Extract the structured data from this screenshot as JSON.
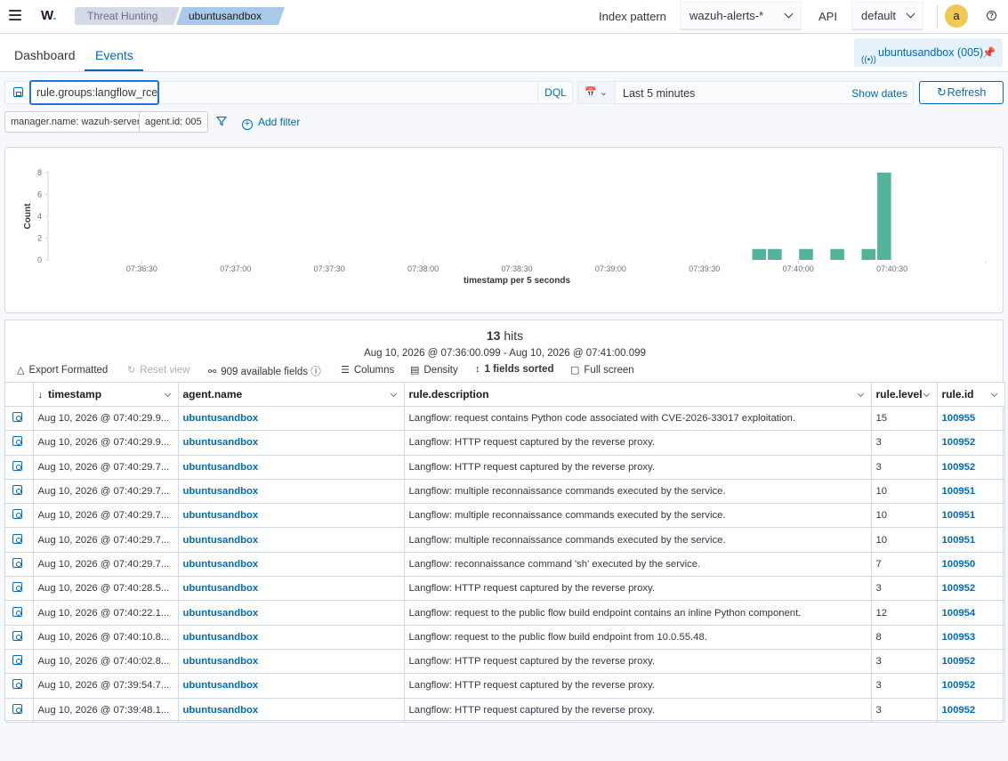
{
  "header": {
    "logo": "W",
    "breadcrumbs": [
      "Threat Hunting",
      "ubuntusandbox"
    ],
    "index_pattern_label": "Index pattern",
    "index_pattern_value": "wazuh-alerts-*",
    "api_label": "API",
    "api_value": "default",
    "avatar_letter": "a",
    "help": "?"
  },
  "tabs": [
    {
      "label": "Dashboard",
      "active": false
    },
    {
      "label": "Events",
      "active": true
    }
  ],
  "agent_pill": "ubuntusandbox (005)",
  "search": {
    "query": "rule.groups:langflow_rce",
    "language": "DQL"
  },
  "date_picker": {
    "value": "Last 5 minutes",
    "show_dates": "Show dates",
    "refresh": "Refresh"
  },
  "filters": {
    "pills": [
      "manager.name: wazuh-server",
      "agent.id: 005"
    ],
    "add_filter": "Add filter"
  },
  "chart_data": {
    "type": "bar",
    "ylabel": "Count",
    "xlabel": "timestamp per 5 seconds",
    "y_ticks": [
      0,
      2,
      4,
      6,
      8
    ],
    "ylim": [
      0,
      8
    ],
    "x_tick_labels": [
      "07:36:30",
      "07:37:00",
      "07:37:30",
      "07:38:00",
      "07:38:30",
      "07:39:00",
      "07:39:30",
      "07:40:00",
      "07:40:30"
    ],
    "x_range": [
      "07:36:00",
      "07:41:00"
    ],
    "bars": [
      {
        "x": "07:39:45",
        "value": 1
      },
      {
        "x": "07:39:50",
        "value": 1
      },
      {
        "x": "07:40:00",
        "value": 1
      },
      {
        "x": "07:40:10",
        "value": 1
      },
      {
        "x": "07:40:20",
        "value": 1
      },
      {
        "x": "07:40:25",
        "value": 8
      }
    ],
    "color": "#54b399"
  },
  "results": {
    "hits_count": "13",
    "hits_label": "hits",
    "range": "Aug 10, 2026 @ 07:36:00.099 - Aug 10, 2026 @ 07:41:00.099",
    "toolbar": {
      "export": "Export Formatted",
      "reset": "Reset view",
      "fields": "909 available fields",
      "columns": "Columns",
      "density": "Density",
      "sorted": "1 fields sorted",
      "fullscreen": "Full screen"
    },
    "columns": [
      "timestamp",
      "agent.name",
      "rule.description",
      "rule.level",
      "rule.id"
    ],
    "rows": [
      {
        "timestamp": "Aug 10, 2026 @ 07:40:29.9...",
        "agent": "ubuntusandbox",
        "description": "Langflow: request contains Python code associated with CVE-2026-33017 exploitation.",
        "level": "15",
        "id": "100955"
      },
      {
        "timestamp": "Aug 10, 2026 @ 07:40:29.9...",
        "agent": "ubuntusandbox",
        "description": "Langflow: HTTP request captured by the reverse proxy.",
        "level": "3",
        "id": "100952"
      },
      {
        "timestamp": "Aug 10, 2026 @ 07:40:29.7...",
        "agent": "ubuntusandbox",
        "description": "Langflow: HTTP request captured by the reverse proxy.",
        "level": "3",
        "id": "100952"
      },
      {
        "timestamp": "Aug 10, 2026 @ 07:40:29.7...",
        "agent": "ubuntusandbox",
        "description": "Langflow: multiple reconnaissance commands executed by the service.",
        "level": "10",
        "id": "100951"
      },
      {
        "timestamp": "Aug 10, 2026 @ 07:40:29.7...",
        "agent": "ubuntusandbox",
        "description": "Langflow: multiple reconnaissance commands executed by the service.",
        "level": "10",
        "id": "100951"
      },
      {
        "timestamp": "Aug 10, 2026 @ 07:40:29.7...",
        "agent": "ubuntusandbox",
        "description": "Langflow: multiple reconnaissance commands executed by the service.",
        "level": "10",
        "id": "100951"
      },
      {
        "timestamp": "Aug 10, 2026 @ 07:40:29.7...",
        "agent": "ubuntusandbox",
        "description": "Langflow: reconnaissance command 'sh' executed by the service.",
        "level": "7",
        "id": "100950"
      },
      {
        "timestamp": "Aug 10, 2026 @ 07:40:28.5...",
        "agent": "ubuntusandbox",
        "description": "Langflow: HTTP request captured by the reverse proxy.",
        "level": "3",
        "id": "100952"
      },
      {
        "timestamp": "Aug 10, 2026 @ 07:40:22.1...",
        "agent": "ubuntusandbox",
        "description": "Langflow: request to the public flow build endpoint contains an inline Python component.",
        "level": "12",
        "id": "100954"
      },
      {
        "timestamp": "Aug 10, 2026 @ 07:40:10.8...",
        "agent": "ubuntusandbox",
        "description": "Langflow: request to the public flow build endpoint from 10.0.55.48.",
        "level": "8",
        "id": "100953"
      },
      {
        "timestamp": "Aug 10, 2026 @ 07:40:02.8...",
        "agent": "ubuntusandbox",
        "description": "Langflow: HTTP request captured by the reverse proxy.",
        "level": "3",
        "id": "100952"
      },
      {
        "timestamp": "Aug 10, 2026 @ 07:39:54.7...",
        "agent": "ubuntusandbox",
        "description": "Langflow: HTTP request captured by the reverse proxy.",
        "level": "3",
        "id": "100952"
      },
      {
        "timestamp": "Aug 10, 2026 @ 07:39:48.1...",
        "agent": "ubuntusandbox",
        "description": "Langflow: HTTP request captured by the reverse proxy.",
        "level": "3",
        "id": "100952"
      }
    ]
  }
}
